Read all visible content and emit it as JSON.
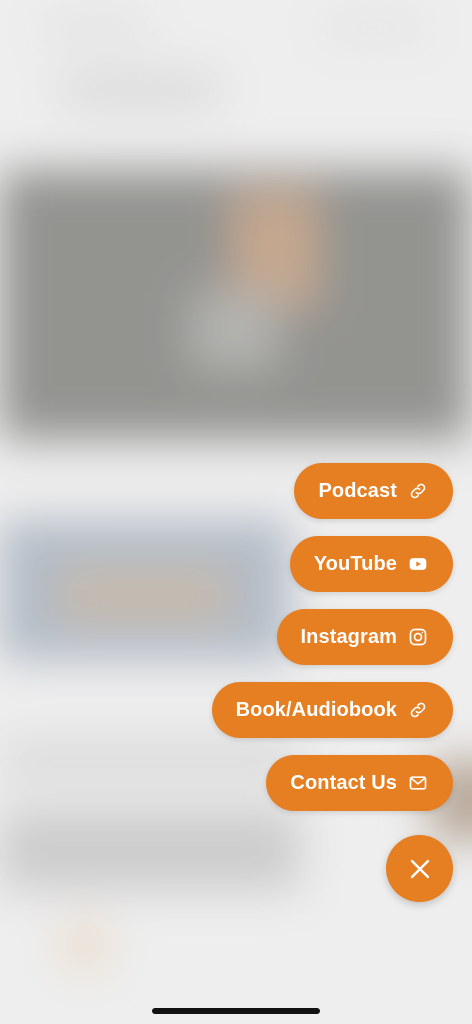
{
  "menu": {
    "items": [
      {
        "label": "Podcast",
        "icon": "link-icon"
      },
      {
        "label": "YouTube",
        "icon": "youtube-icon"
      },
      {
        "label": "Instagram",
        "icon": "instagram-icon"
      },
      {
        "label": "Book/Audiobook",
        "icon": "link-icon"
      },
      {
        "label": "Contact Us",
        "icon": "mail-icon"
      }
    ],
    "close_icon": "close-icon"
  },
  "colors": {
    "accent": "#e67e22",
    "text_on_accent": "#ffffff",
    "home_indicator": "#111111"
  }
}
